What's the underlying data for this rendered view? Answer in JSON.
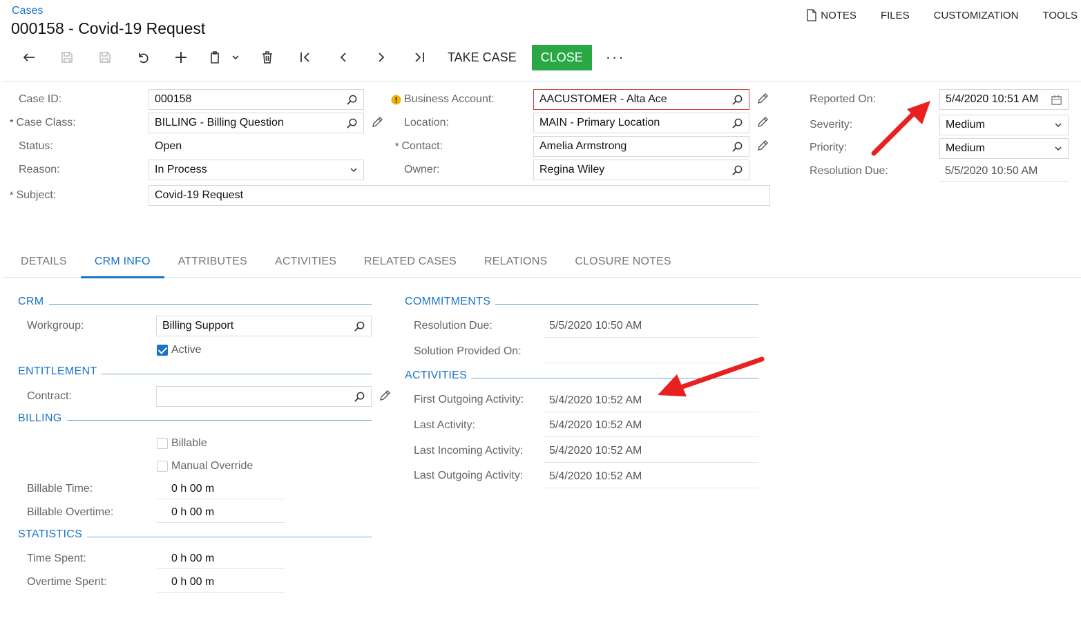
{
  "header": {
    "breadcrumb": "Cases",
    "title": "000158 - Covid-19 Request",
    "links": {
      "notes": "NOTES",
      "files": "FILES",
      "customization": "CUSTOMIZATION",
      "tools": "TOOLS"
    }
  },
  "toolbar": {
    "take_case": "TAKE CASE",
    "close": "CLOSE",
    "more": "···"
  },
  "form": {
    "case_id_label": "Case ID:",
    "case_id": "000158",
    "case_class_label": "Case Class:",
    "case_class": "BILLING - Billing Question",
    "status_label": "Status:",
    "status": "Open",
    "reason_label": "Reason:",
    "reason": "In Process",
    "subject_label": "Subject:",
    "subject": "Covid-19 Request",
    "business_account_label": "Business Account:",
    "business_account": "AACUSTOMER - Alta Ace",
    "location_label": "Location:",
    "location": "MAIN - Primary Location",
    "contact_label": "Contact:",
    "contact": "Amelia Armstrong",
    "owner_label": "Owner:",
    "owner": "Regina Wiley",
    "reported_on_label": "Reported On:",
    "reported_on": "5/4/2020 10:51 AM",
    "severity_label": "Severity:",
    "severity": "Medium",
    "priority_label": "Priority:",
    "priority": "Medium",
    "resolution_due_label": "Resolution Due:",
    "resolution_due": "5/5/2020 10:50 AM",
    "required_mark": "*"
  },
  "tabs": [
    "DETAILS",
    "CRM INFO",
    "ATTRIBUTES",
    "ACTIVITIES",
    "RELATED CASES",
    "RELATIONS",
    "CLOSURE NOTES"
  ],
  "crm": {
    "section_crm": "CRM",
    "workgroup_label": "Workgroup:",
    "workgroup": "Billing Support",
    "active_label": "Active",
    "section_entitlement": "ENTITLEMENT",
    "contract_label": "Contract:",
    "contract": "",
    "section_billing": "BILLING",
    "billable_label": "Billable",
    "manual_override_label": "Manual Override",
    "billable_time_label": "Billable Time:",
    "billable_time": "0 h 00 m",
    "billable_overtime_label": "Billable Overtime:",
    "billable_overtime": "0 h 00 m",
    "section_statistics": "STATISTICS",
    "time_spent_label": "Time Spent:",
    "time_spent": "0 h 00 m",
    "overtime_spent_label": "Overtime Spent:",
    "overtime_spent": "0 h 00 m"
  },
  "commitments": {
    "section_commitments": "COMMITMENTS",
    "resolution_due_label": "Resolution Due:",
    "resolution_due": "5/5/2020 10:50 AM",
    "solution_provided_label": "Solution Provided On:",
    "solution_provided": "",
    "section_activities": "ACTIVITIES",
    "first_outgoing_label": "First Outgoing Activity:",
    "first_outgoing": "5/4/2020 10:52 AM",
    "last_activity_label": "Last Activity:",
    "last_activity": "5/4/2020 10:52 AM",
    "last_incoming_label": "Last Incoming Activity:",
    "last_incoming": "5/4/2020 10:52 AM",
    "last_outgoing_label": "Last Outgoing Activity:",
    "last_outgoing": "5/4/2020 10:52 AM"
  },
  "colors": {
    "accent": "#1a73c9",
    "close_button": "#2aa845",
    "error_border": "#d23b3b",
    "annotation_arrow": "#e8201f"
  }
}
